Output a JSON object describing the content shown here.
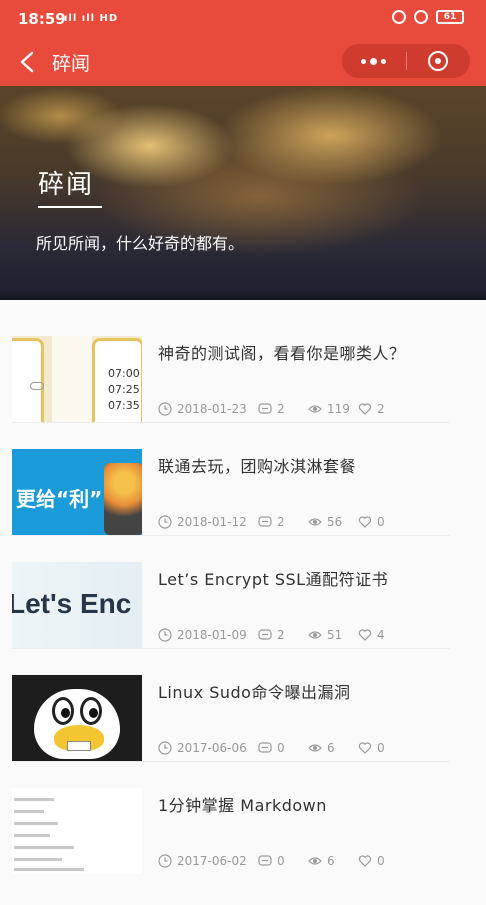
{
  "status_bar": {
    "time": "18:59",
    "signal": "all ᵍᵃll all",
    "network": "HD",
    "battery": "61"
  },
  "nav": {
    "title": "碎闻",
    "back_icon": "chevron-left-icon",
    "menu_icon": "more-dots-icon",
    "close_icon": "target-circle-icon"
  },
  "hero": {
    "title": "碎闻",
    "subtitle": "所见所闻，什么好奇的都有。"
  },
  "articles": [
    {
      "title": "神奇的测试阁，看看你是哪类人？",
      "date": "2018-01-23",
      "comments": "2",
      "views": "119",
      "likes": "2",
      "thumb_times": [
        "07:00",
        "07:25",
        "07:35"
      ]
    },
    {
      "title": "联通去玩，团购冰淇淋套餐",
      "date": "2018-01-12",
      "comments": "2",
      "views": "56",
      "likes": "0",
      "thumb_text": "更给“利”"
    },
    {
      "title": "Let’s Encrypt SSL通配符证书",
      "date": "2018-01-09",
      "comments": "2",
      "views": "51",
      "likes": "4",
      "thumb_text": "Let's Enc"
    },
    {
      "title": "Linux Sudo命令曝出漏洞",
      "date": "2017-06-06",
      "comments": "0",
      "views": "6",
      "likes": "0"
    },
    {
      "title": "1分钟掌握 Markdown",
      "date": "2017-06-02",
      "comments": "0",
      "views": "6",
      "likes": "0"
    }
  ],
  "colors": {
    "brand_red": "#e84a3c",
    "meta_gray": "#9a9a9a"
  }
}
